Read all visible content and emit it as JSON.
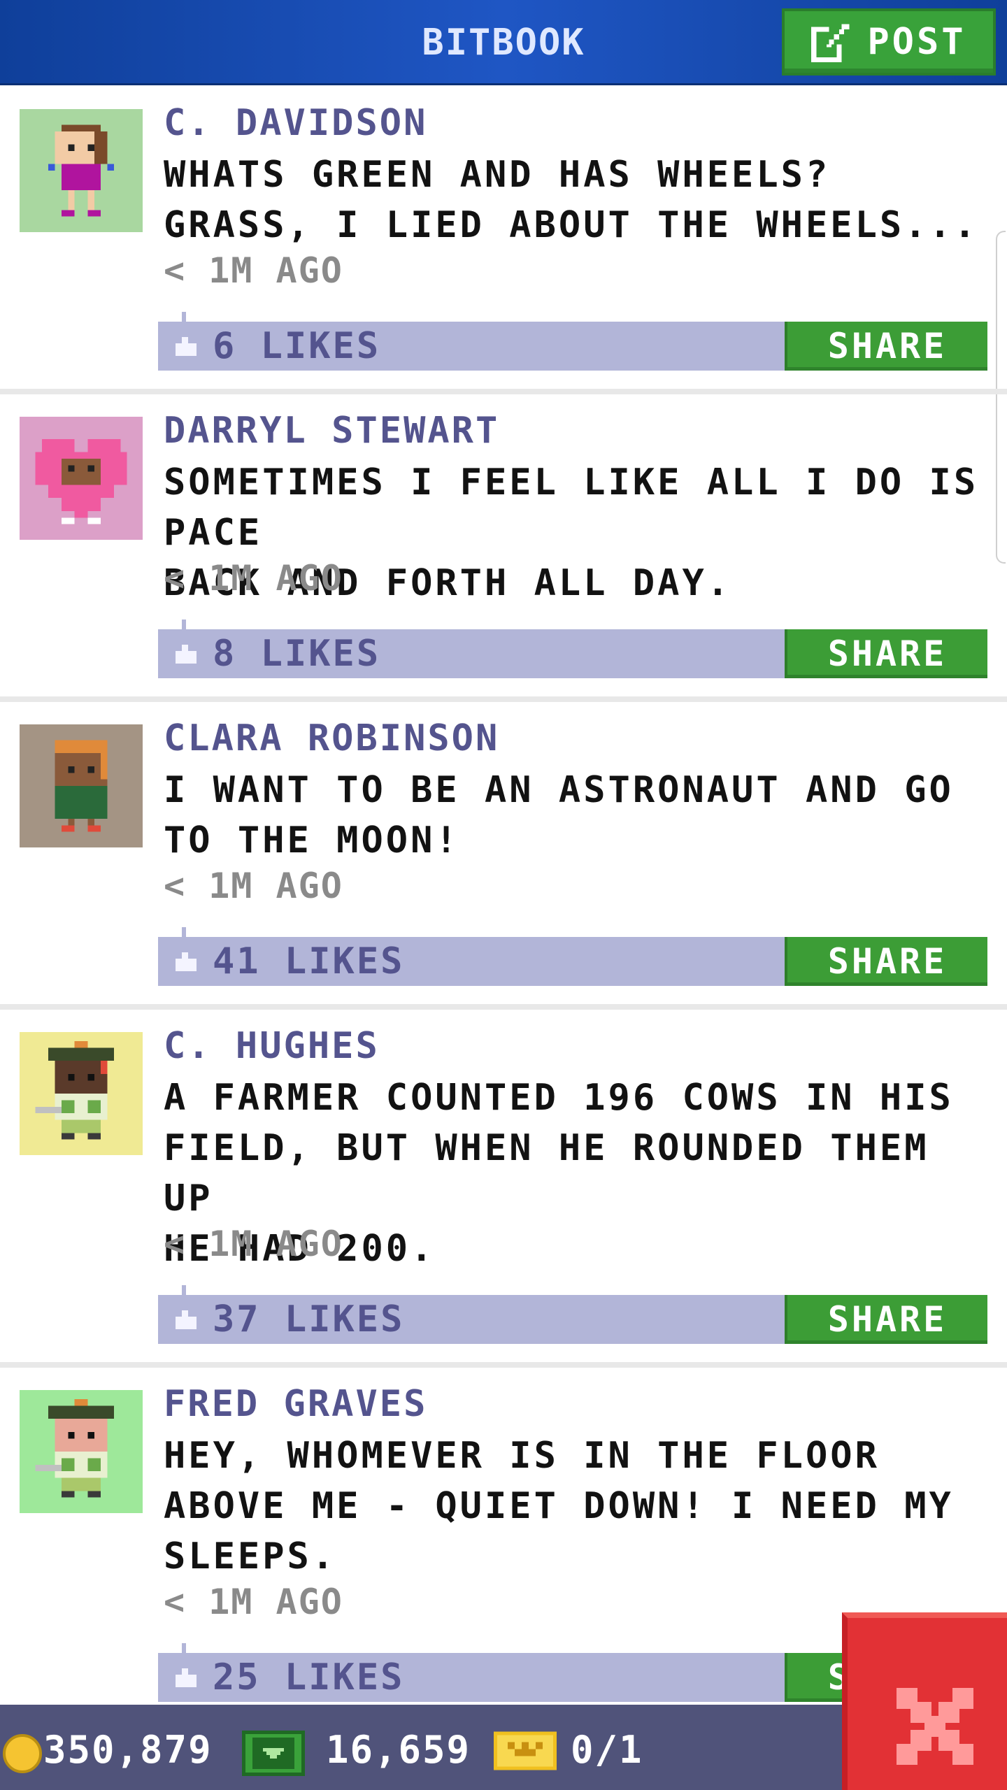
{
  "header": {
    "title": "BITBOOK",
    "post_label": "POST"
  },
  "colors": {
    "header_blue": "#1f56c4",
    "accent_green": "#39a23a",
    "likes_bar": "#b2b5d8",
    "author_text": "#54548e",
    "close_red": "#e23135"
  },
  "posts": [
    {
      "author": "C. DAVIDSON",
      "message": "WHATS GREEN AND HAS WHEELS?\nGRASS, I LIED ABOUT THE WHEELS...",
      "time": "< 1M AGO",
      "likes": "6 LIKES",
      "share_label": "SHARE",
      "avatar": "avatar-pink-shirt-girl"
    },
    {
      "author": "DARRYL STEWART",
      "message": "SOMETIMES I FEEL LIKE ALL I DO IS PACE\nBACK AND FORTH ALL DAY.",
      "time": "< 1M AGO",
      "likes": "8 LIKES",
      "share_label": "SHARE",
      "avatar": "avatar-heart-costume"
    },
    {
      "author": "CLARA ROBINSON",
      "message": "I WANT TO BE AN ASTRONAUT AND GO\nTO THE MOON!",
      "time": "< 1M AGO",
      "likes": "41 LIKES",
      "share_label": "SHARE",
      "avatar": "avatar-green-shirt"
    },
    {
      "author": "C. HUGHES",
      "message": "A FARMER COUNTED 196 COWS IN HIS\nFIELD, BUT WHEN HE ROUNDED THEM UP\nHE HAD 200.",
      "time": "< 1M AGO",
      "likes": "37 LIKES",
      "share_label": "SHARE",
      "avatar": "avatar-golfer"
    },
    {
      "author": "FRED GRAVES",
      "message": "HEY, WHOMEVER IS IN THE FLOOR\nABOVE ME - QUIET DOWN! I NEED MY\nSLEEPS.",
      "time": "< 1M AGO",
      "likes": "25 LIKES",
      "share_label": "SHARE",
      "avatar": "avatar-golfer"
    }
  ],
  "status": {
    "coins": "350,879",
    "bux": "16,659",
    "vip": "0/1"
  }
}
